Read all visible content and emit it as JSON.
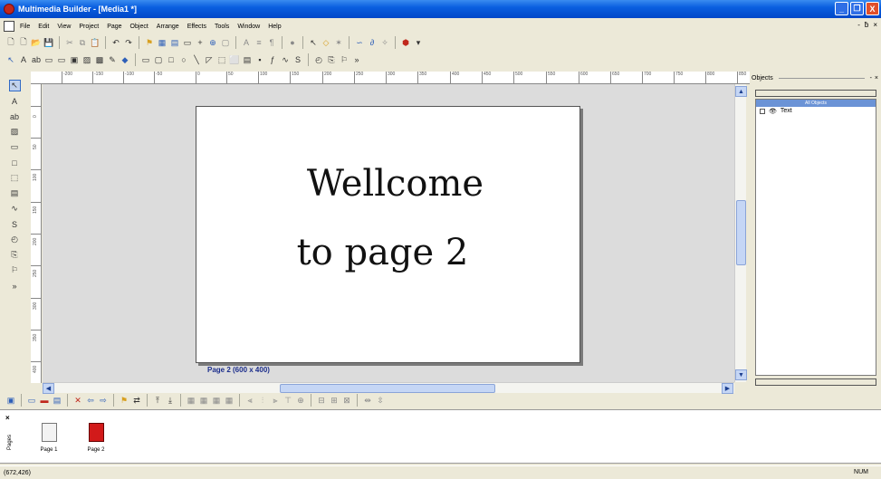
{
  "window": {
    "title": "Multimedia Builder - [Media1 *]",
    "controls": [
      "_",
      "❐",
      "X"
    ]
  },
  "menu": {
    "items": [
      "File",
      "Edit",
      "View",
      "Project",
      "Page",
      "Object",
      "Arrange",
      "Effects",
      "Tools",
      "Window",
      "Help"
    ],
    "mdi": [
      "-",
      "ƀ",
      "×"
    ]
  },
  "ruler": {
    "h_ticks": [
      "-200",
      "-150",
      "-100",
      "-50",
      "0",
      "50",
      "100",
      "150",
      "200",
      "250",
      "300",
      "350",
      "400",
      "450",
      "500",
      "550",
      "600",
      "650",
      "700",
      "750",
      "800",
      "850"
    ],
    "v_ticks": [
      "0",
      "50",
      "100",
      "150",
      "200",
      "250",
      "300",
      "350",
      "400"
    ]
  },
  "canvas": {
    "line1": "Wellcome",
    "line2": "to page 2",
    "page_label": "Page 2 (600 x 400)"
  },
  "objects_panel": {
    "title": "Objects",
    "list_header": "All Objects",
    "items": [
      {
        "label": "Text"
      }
    ]
  },
  "pages": {
    "tab_label": "Pages",
    "close": "×",
    "thumbs": [
      {
        "label": "Page 1"
      },
      {
        "label": "Page 2"
      }
    ]
  },
  "status": {
    "coords": "(672,426)",
    "num": "NUM"
  },
  "colors": {
    "titlebar": "#0a5fe0",
    "page2_thumb": "#d21a1a",
    "page_label": "#1c2e8c"
  }
}
